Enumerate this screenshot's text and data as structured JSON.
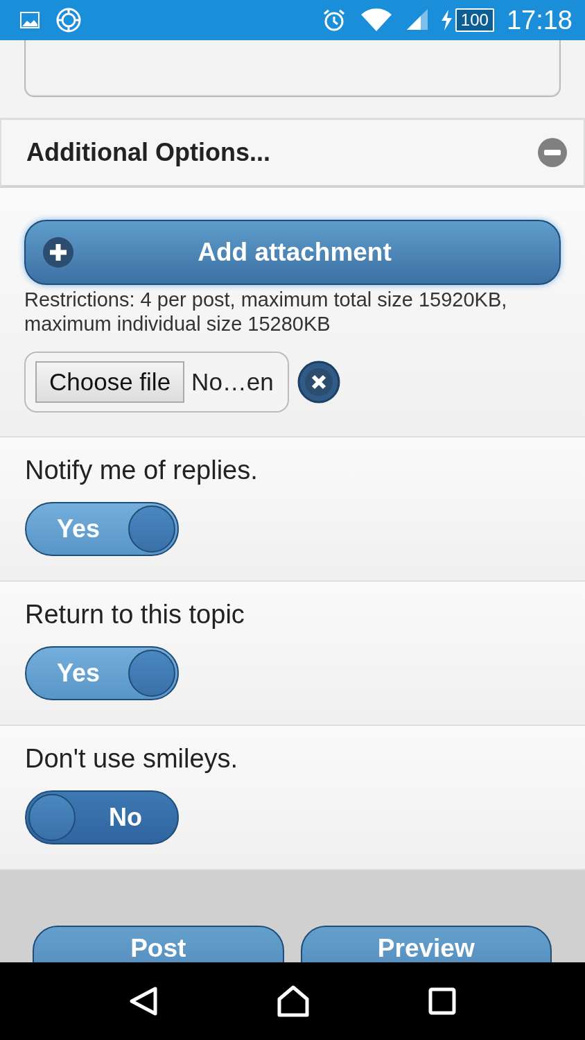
{
  "status_bar": {
    "battery": "100",
    "time": "17:18"
  },
  "additional_options": {
    "title": "Additional Options...",
    "expanded": true
  },
  "attachments": {
    "button": "Add attachment",
    "restrictions": "Restrictions: 4 per post, maximum total size 15920KB, maximum individual size 15280KB",
    "choose_file": "Choose file",
    "file_name": "No…en"
  },
  "options": [
    {
      "label": "Notify me of replies.",
      "on": true,
      "value": "Yes"
    },
    {
      "label": "Return to this topic",
      "on": true,
      "value": "Yes"
    },
    {
      "label": "Don't use smileys.",
      "on": false,
      "value": "No"
    }
  ],
  "buttons": [
    "Post",
    "Preview"
  ]
}
